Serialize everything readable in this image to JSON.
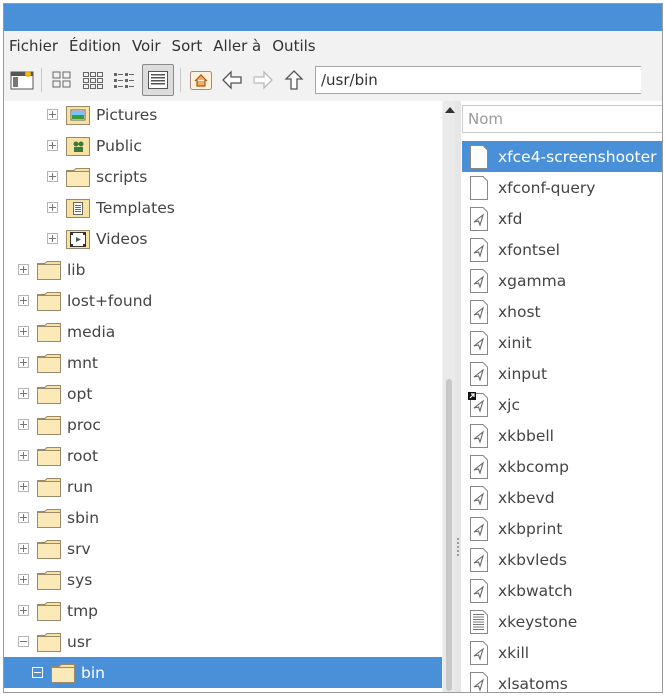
{
  "menubar": [
    "Fichier",
    "Édition",
    "Voir",
    "Sort",
    "Aller à",
    "Outils"
  ],
  "path": "/usr/bin",
  "tree": [
    {
      "name": "Pictures",
      "level": 1,
      "icon": "pictures-folder-icon",
      "expander": "plus"
    },
    {
      "name": "Public",
      "level": 1,
      "icon": "public-folder-icon",
      "expander": "plus"
    },
    {
      "name": "scripts",
      "level": 1,
      "icon": "folder-icon",
      "expander": "plus"
    },
    {
      "name": "Templates",
      "level": 1,
      "icon": "templates-folder-icon",
      "expander": "plus"
    },
    {
      "name": "Videos",
      "level": 1,
      "icon": "videos-folder-icon",
      "expander": "plus"
    },
    {
      "name": "lib",
      "level": 0,
      "icon": "folder-icon",
      "expander": "plus"
    },
    {
      "name": "lost+found",
      "level": 0,
      "icon": "folder-icon",
      "expander": "plus"
    },
    {
      "name": "media",
      "level": 0,
      "icon": "folder-icon",
      "expander": "plus"
    },
    {
      "name": "mnt",
      "level": 0,
      "icon": "folder-icon",
      "expander": "plus"
    },
    {
      "name": "opt",
      "level": 0,
      "icon": "folder-icon",
      "expander": "plus"
    },
    {
      "name": "proc",
      "level": 0,
      "icon": "folder-icon",
      "expander": "plus"
    },
    {
      "name": "root",
      "level": 0,
      "icon": "folder-icon",
      "expander": "plus"
    },
    {
      "name": "run",
      "level": 0,
      "icon": "folder-icon",
      "expander": "plus"
    },
    {
      "name": "sbin",
      "level": 0,
      "icon": "folder-icon",
      "expander": "plus"
    },
    {
      "name": "srv",
      "level": 0,
      "icon": "folder-icon",
      "expander": "plus"
    },
    {
      "name": "sys",
      "level": 0,
      "icon": "folder-icon",
      "expander": "plus"
    },
    {
      "name": "tmp",
      "level": 0,
      "icon": "folder-icon",
      "expander": "plus"
    },
    {
      "name": "usr",
      "level": 0,
      "icon": "folder-icon",
      "expander": "minus"
    },
    {
      "name": "bin",
      "level": 1,
      "icon": "folder-icon",
      "expander": "minus",
      "selected": true
    }
  ],
  "list_header": "Nom",
  "files": [
    {
      "name": "xfce4-screenshooter",
      "icon": "text-file-icon",
      "selected": true
    },
    {
      "name": "xfconf-query",
      "icon": "blank-file-icon"
    },
    {
      "name": "xfd",
      "icon": "executable-icon"
    },
    {
      "name": "xfontsel",
      "icon": "executable-icon"
    },
    {
      "name": "xgamma",
      "icon": "executable-icon"
    },
    {
      "name": "xhost",
      "icon": "executable-icon"
    },
    {
      "name": "xinit",
      "icon": "executable-icon"
    },
    {
      "name": "xinput",
      "icon": "executable-icon"
    },
    {
      "name": "xjc",
      "icon": "symlink-executable-icon"
    },
    {
      "name": "xkbbell",
      "icon": "executable-icon"
    },
    {
      "name": "xkbcomp",
      "icon": "executable-icon"
    },
    {
      "name": "xkbevd",
      "icon": "executable-icon"
    },
    {
      "name": "xkbprint",
      "icon": "executable-icon"
    },
    {
      "name": "xkbvleds",
      "icon": "executable-icon"
    },
    {
      "name": "xkbwatch",
      "icon": "executable-icon"
    },
    {
      "name": "xkeystone",
      "icon": "script-file-icon"
    },
    {
      "name": "xkill",
      "icon": "executable-icon"
    },
    {
      "name": "xlsatoms",
      "icon": "executable-icon"
    }
  ],
  "colors": {
    "accent": "#4a90d9",
    "folder": "#f7e2a3"
  }
}
